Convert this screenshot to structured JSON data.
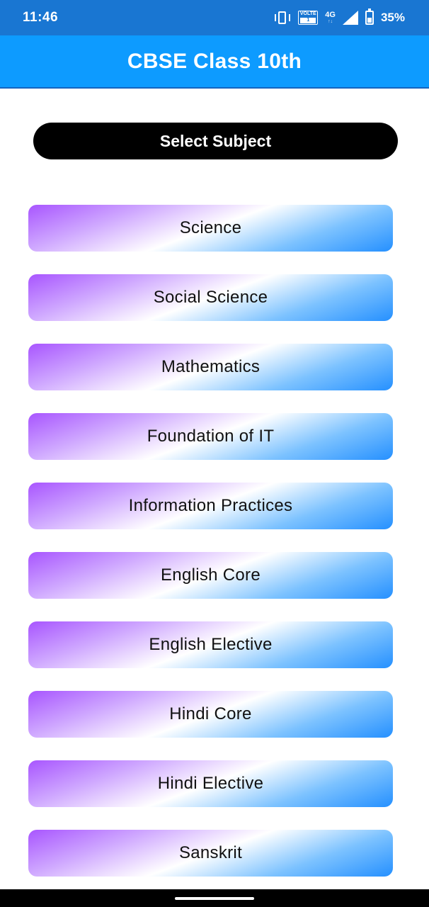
{
  "status_bar": {
    "time": "11:46",
    "volte_text": "VOLTE",
    "volte_sub": "1",
    "network": "4G",
    "battery": "35%",
    "icons": [
      "vibrate-icon",
      "volte-icon",
      "network-4g-icon",
      "signal-icon",
      "battery-icon"
    ]
  },
  "app_bar": {
    "title": "CBSE Class 10th"
  },
  "header": {
    "label": "Select Subject"
  },
  "subjects": [
    {
      "label": "Science"
    },
    {
      "label": "Social Science"
    },
    {
      "label": "Mathematics"
    },
    {
      "label": "Foundation of IT"
    },
    {
      "label": "Information Practices"
    },
    {
      "label": "English Core"
    },
    {
      "label": "English Elective"
    },
    {
      "label": "Hindi Core"
    },
    {
      "label": "Hindi Elective"
    },
    {
      "label": "Sanskrit"
    }
  ],
  "colors": {
    "status_bar": "#1976d2",
    "app_bar": "#0d9bff",
    "gradient_start": "#a855ff",
    "gradient_end": "#2590ff"
  }
}
